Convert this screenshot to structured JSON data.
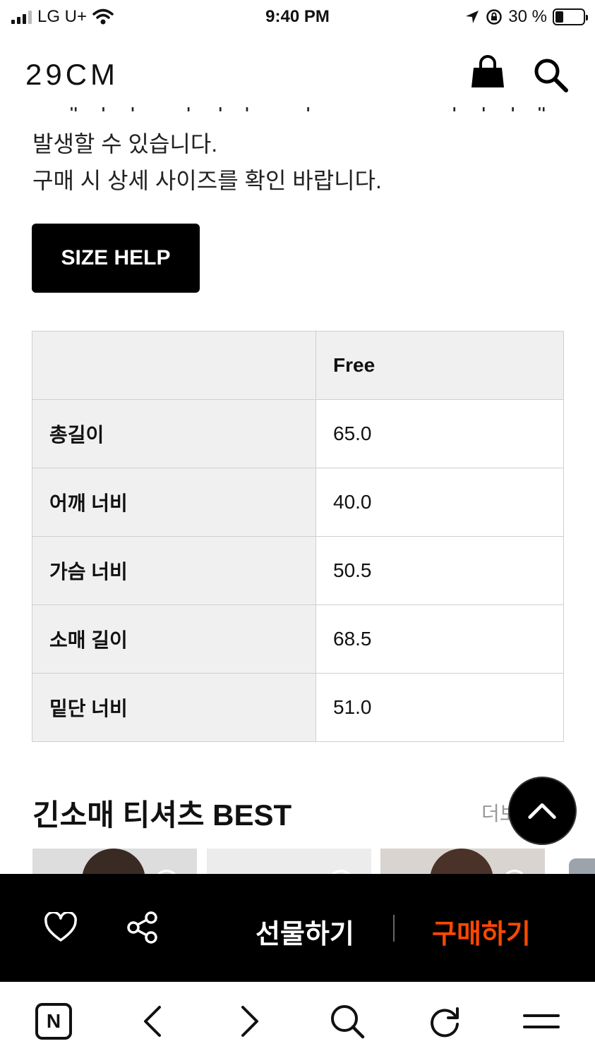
{
  "status": {
    "carrier": "LG U+",
    "time": "9:40 PM",
    "battery": "30 %",
    "battery_level": 0.3
  },
  "header": {
    "logo": "29CM",
    "bag_icon": "shopping-bag-icon",
    "search_icon": "search-icon"
  },
  "description": {
    "line1": "발생할 수 있습니다.",
    "line2": "구매 시 상세 사이즈를 확인 바랍니다."
  },
  "size_help_label": "SIZE HELP",
  "size_table": {
    "header": "Free",
    "rows": [
      {
        "label": "총길이",
        "value": "65.0"
      },
      {
        "label": "어깨 너비",
        "value": "40.0"
      },
      {
        "label": "가슴 너비",
        "value": "50.5"
      },
      {
        "label": "소매 길이",
        "value": "68.5"
      },
      {
        "label": "밑단 너비",
        "value": "51.0"
      }
    ]
  },
  "best": {
    "title": "긴소매 티셔츠 BEST",
    "more": "더보"
  },
  "action_bar": {
    "gift": "선물하기",
    "buy": "구매하기",
    "buy_color": "#ff4800"
  },
  "toolbar": {
    "n_label": "N"
  }
}
